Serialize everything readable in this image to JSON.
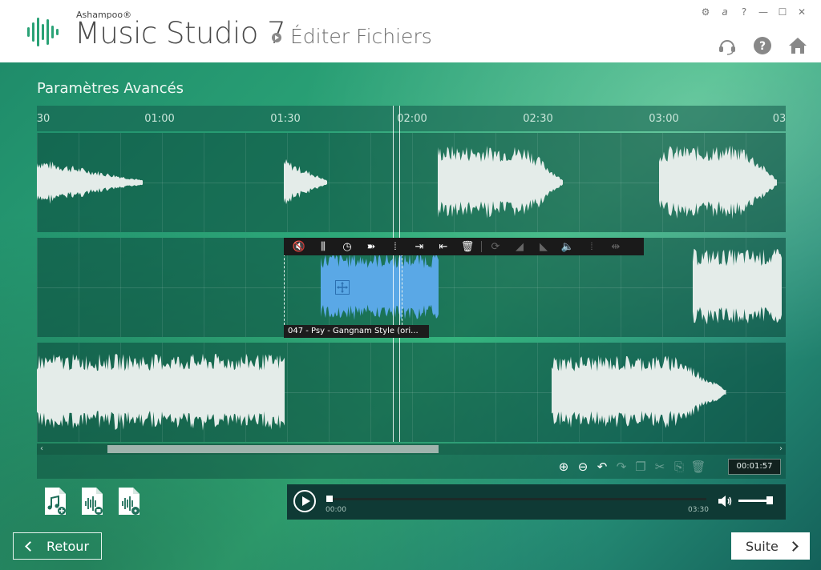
{
  "header": {
    "brand": "Ashampoo®",
    "product": "Music Studio 7",
    "page": "Éditer Fichiers",
    "window_buttons": [
      "⚙",
      "a",
      "?",
      "—",
      "☐",
      "✕"
    ],
    "icons": [
      "support-headset-icon",
      "help-icon",
      "home-icon"
    ]
  },
  "main": {
    "title": "Paramètres Avancés",
    "ruler": {
      "ticks": [
        "30",
        "01:00",
        "01:30",
        "02:00",
        "02:30",
        "03:00",
        "03"
      ]
    },
    "clip": {
      "label": "047 - Psy - Gangnam Style (ori..."
    },
    "clip_tools": [
      {
        "name": "mute-icon",
        "glyph": "🔇",
        "enabled": true
      },
      {
        "name": "equalizer-icon",
        "glyph": "⫼",
        "enabled": true
      },
      {
        "name": "clock-icon",
        "glyph": "◷",
        "enabled": true
      },
      {
        "name": "speed-runner-icon",
        "glyph": "➽",
        "enabled": true
      },
      {
        "name": "waveform-icon",
        "glyph": "⦙",
        "enabled": true
      },
      {
        "name": "snap-right-icon",
        "glyph": "⇥",
        "enabled": true
      },
      {
        "name": "snap-left-icon",
        "glyph": "⇤",
        "enabled": true
      },
      {
        "name": "delete-icon",
        "glyph": "🗑",
        "enabled": true
      },
      {
        "name": "loop-icon",
        "glyph": "⟳",
        "enabled": false
      },
      {
        "name": "fade-in-icon",
        "glyph": "◢",
        "enabled": false
      },
      {
        "name": "fade-out-icon",
        "glyph": "◣",
        "enabled": false
      },
      {
        "name": "volume-icon",
        "glyph": "🔈",
        "enabled": false
      },
      {
        "name": "normalize-icon",
        "glyph": "⦙",
        "enabled": false
      },
      {
        "name": "split-icon",
        "glyph": "⇹",
        "enabled": false
      }
    ],
    "edit_tools": [
      {
        "name": "zoom-in-icon",
        "glyph": "⊕",
        "enabled": true
      },
      {
        "name": "zoom-out-icon",
        "glyph": "⊖",
        "enabled": true
      },
      {
        "name": "undo-icon",
        "glyph": "↶",
        "enabled": true
      },
      {
        "name": "redo-icon",
        "glyph": "↷",
        "enabled": false
      },
      {
        "name": "copy-icon",
        "glyph": "❐",
        "enabled": false
      },
      {
        "name": "cut-icon",
        "glyph": "✂",
        "enabled": false
      },
      {
        "name": "paste-icon",
        "glyph": "⎘",
        "enabled": false
      },
      {
        "name": "trash-icon",
        "glyph": "🗑",
        "enabled": false
      }
    ],
    "timecode": "00:01:57",
    "player": {
      "start": "00:00",
      "end": "03:30",
      "progress": 0.0,
      "volume": 0.9
    },
    "add_buttons": [
      "add-music-file-icon",
      "add-from-recorder-icon",
      "add-from-cd-icon"
    ]
  },
  "footer": {
    "back_label": "Retour",
    "next_label": "Suite"
  },
  "colors": {
    "accent_green": "#2aa276",
    "clip_blue": "#5aa8e6",
    "wave_white": "#e4ece9"
  }
}
